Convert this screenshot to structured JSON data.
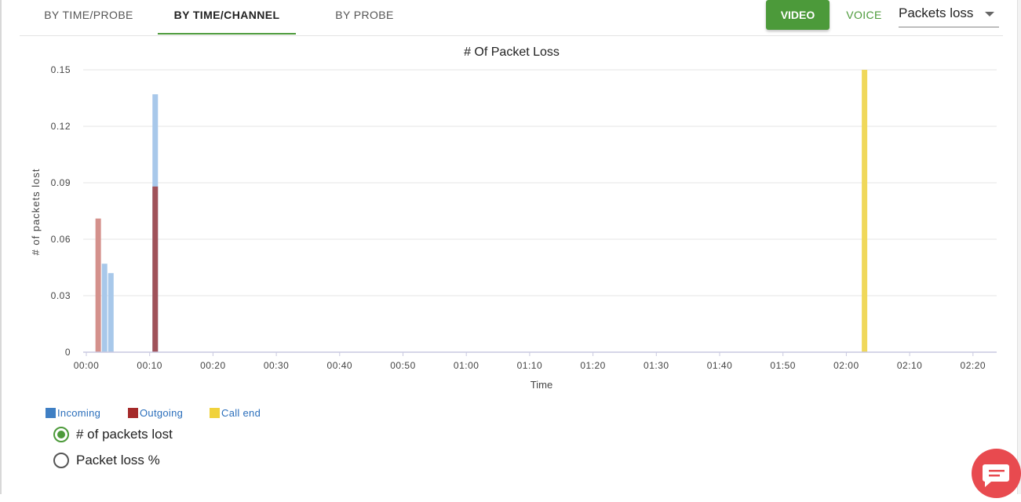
{
  "tabs": [
    {
      "label": "BY TIME/PROBE",
      "active": false
    },
    {
      "label": "BY TIME/CHANNEL",
      "active": true
    },
    {
      "label": "BY PROBE",
      "active": false
    }
  ],
  "toolbar": {
    "video_label": "VIDEO",
    "voice_label": "VOICE",
    "metric_select": "Packets loss"
  },
  "legend": [
    {
      "label": "Incoming",
      "color": "#3f7fc4"
    },
    {
      "label": "Outgoing",
      "color": "#a52a2a"
    },
    {
      "label": "Call end",
      "color": "#f0d23c"
    }
  ],
  "radios": [
    {
      "label": "# of packets lost",
      "selected": true
    },
    {
      "label": "Packet loss %",
      "selected": false
    }
  ],
  "colors": {
    "accent": "#4c9a3a",
    "incoming": "#a8c8ea",
    "outgoing": "#a0525a",
    "outgoing_light": "#d4918c",
    "call_end": "#f0d85a",
    "chat": "#e84a4f"
  },
  "chart_data": {
    "type": "bar",
    "title": "# Of Packet Loss",
    "xlabel": "Time",
    "ylabel": "# of packets lost",
    "ylim": [
      0,
      0.15
    ],
    "yticks": [
      "0",
      "0.03",
      "0.06",
      "0.09",
      "0.12",
      "0.15"
    ],
    "xticks": [
      "00:00",
      "00:10",
      "00:20",
      "00:30",
      "00:40",
      "00:50",
      "01:00",
      "01:10",
      "01:20",
      "01:30",
      "01:40",
      "01:50",
      "02:00",
      "02:10",
      "02:20"
    ],
    "grid": true,
    "series": [
      {
        "name": "Incoming",
        "points": [
          {
            "t": "00:03",
            "value": 0.047
          },
          {
            "t": "00:04",
            "value": 0.042
          },
          {
            "t": "00:11",
            "value": 0.137
          }
        ]
      },
      {
        "name": "Outgoing",
        "points": [
          {
            "t": "00:02",
            "value": 0.071
          },
          {
            "t": "00:11",
            "value": 0.088
          }
        ]
      },
      {
        "name": "Call end",
        "points": [
          {
            "t": "02:03",
            "value": 0.15
          }
        ]
      }
    ]
  }
}
